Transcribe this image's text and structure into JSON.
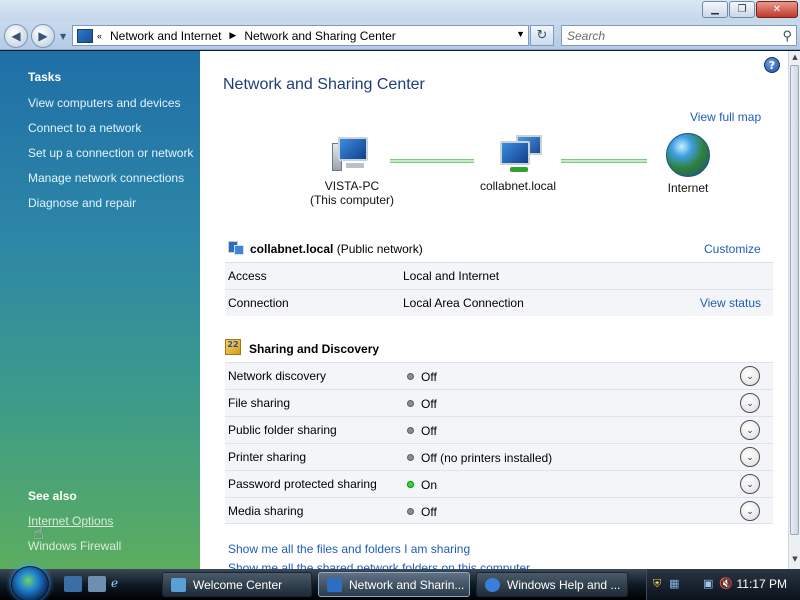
{
  "window": {
    "minimize": "▁",
    "maximize": "❐",
    "close": "✕"
  },
  "address": {
    "back_icon": "◀",
    "forward_icon": "▶",
    "prefix": "«",
    "crumbs": [
      "Network and Internet",
      "Network and Sharing Center"
    ],
    "separator": "▶",
    "dropdown": "▼",
    "refresh": "↻",
    "search_placeholder": "Search",
    "search_icon": "⚲"
  },
  "sidebar": {
    "tasks_heading": "Tasks",
    "tasks": [
      "View computers and devices",
      "Connect to a network",
      "Set up a connection or network",
      "Manage network connections",
      "Diagnose and repair"
    ],
    "see_also_heading": "See also",
    "see_also": [
      "Internet Options",
      "Windows Firewall"
    ]
  },
  "main": {
    "help_icon": "?",
    "title": "Network and Sharing Center",
    "view_full_map": "View full map",
    "map": {
      "computer_name": "VISTA-PC",
      "computer_sub": "(This computer)",
      "network_name": "collabnet.local",
      "internet": "Internet"
    },
    "network": {
      "name": "collabnet.local",
      "type": "(Public network)",
      "customize": "Customize",
      "rows": [
        {
          "label": "Access",
          "value": "Local and Internet",
          "action": ""
        },
        {
          "label": "Connection",
          "value": "Local Area Connection",
          "action": "View status"
        }
      ]
    },
    "sharing": {
      "heading": "Sharing and Discovery",
      "expand_icon": "⌄",
      "rows": [
        {
          "label": "Network discovery",
          "value": "Off",
          "on": false
        },
        {
          "label": "File sharing",
          "value": "Off",
          "on": false
        },
        {
          "label": "Public folder sharing",
          "value": "Off",
          "on": false
        },
        {
          "label": "Printer sharing",
          "value": "Off (no printers installed)",
          "on": false
        },
        {
          "label": "Password protected sharing",
          "value": "On",
          "on": true
        },
        {
          "label": "Media sharing",
          "value": "Off",
          "on": false
        }
      ]
    },
    "bottom_links": [
      "Show me all the files and folders I am sharing",
      "Show me all the shared network folders on this computer"
    ]
  },
  "taskbar": {
    "items": [
      {
        "label": "Welcome Center",
        "active": false
      },
      {
        "label": "Network and Sharin...",
        "active": true
      },
      {
        "label": "Windows Help and ...",
        "active": false
      }
    ],
    "clock": "11:17 PM"
  },
  "colors": {
    "link": "#1f5db8",
    "title": "#1e3e78",
    "status_on": "#3bd43b",
    "status_off": "#8c8c8c"
  }
}
